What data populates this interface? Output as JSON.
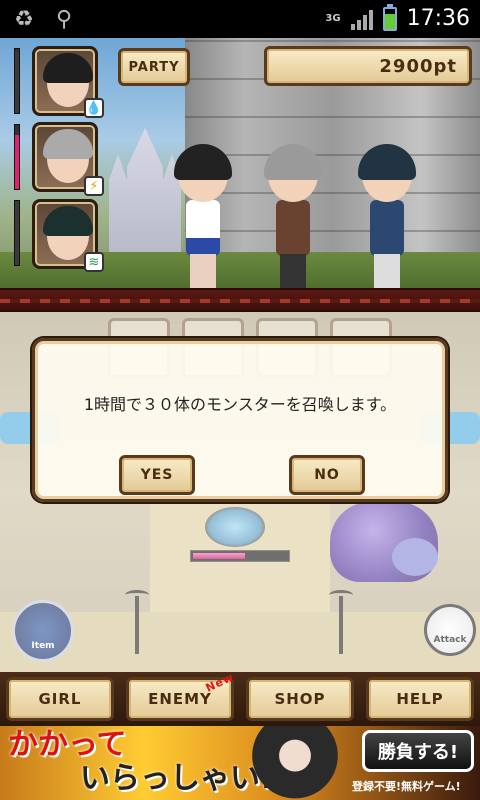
{
  "status_bar": {
    "time": "17:36",
    "network": "3G",
    "icons": [
      "recycle-icon",
      "usb-icon",
      "signal-icon",
      "battery-charging-icon"
    ]
  },
  "party": {
    "button_label": "PARTY",
    "points": "2900pt",
    "members": [
      {
        "element": "water",
        "element_icon": "water-drop-icon",
        "hp": 0.95,
        "hp_color": "#3a3a3a"
      },
      {
        "element": "thunder",
        "element_icon": "lightning-icon",
        "hp": 0.85,
        "hp_color": "#e0226f"
      },
      {
        "element": "wind",
        "element_icon": "wind-icon",
        "hp": 1.0,
        "hp_color": "#3a3a3a"
      }
    ]
  },
  "field": {
    "monster_hp": 0.55,
    "item_label": "Item",
    "attack_label": "Attack"
  },
  "dialog": {
    "message": "1時間で３０体のモンスターを召喚します。",
    "yes_label": "YES",
    "no_label": "NO"
  },
  "nav": {
    "girl": "GIRL",
    "enemy": "ENEMY",
    "enemy_badge": "New",
    "shop": "SHOP",
    "help": "HELP"
  },
  "ad": {
    "headline_line1": "かかって",
    "headline_line2": "いらっしゃい!",
    "cta": "勝負する!",
    "cta_sub": "登録不要!無料ゲーム!"
  },
  "colors": {
    "accent_gold": "#e3c996",
    "frame_brown": "#5a3a1e",
    "hp_pink": "#e0226f"
  }
}
